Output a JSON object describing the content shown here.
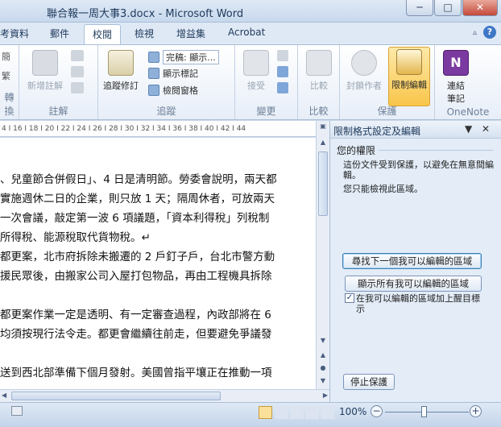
{
  "window": {
    "title": "聯合報一周大事3.docx - Microsoft Word",
    "minimize": "─",
    "maximize": "□",
    "close": "✕"
  },
  "tabs": [
    "考資料",
    "郵件",
    "校閱",
    "檢視",
    "增益集",
    "Acrobat"
  ],
  "active_tab": "校閱",
  "ribbon": {
    "groups": {
      "proofing": "轉換",
      "comments": "註解",
      "tracking": "追蹤",
      "changes": "變更",
      "compare": "比較",
      "protect": "保護",
      "onenote": "OneNote"
    },
    "left_partial_labels": [
      "簡",
      "繁",
      "轉換"
    ],
    "new_comment": "新增註解",
    "track_changes": "追蹤修訂",
    "final_markup_dropdown": "完稿: 顯示...",
    "show_markup": "顯示標記",
    "reviewing_pane": "檢閱窗格",
    "accept": "接受",
    "compare": "比較",
    "block_authors": "封鎖作者",
    "restrict_editing": "限制編輯",
    "linked_notes": "連結\n筆記"
  },
  "ruler_text": "4 I 16 I 18 I 20 I 22 I 24 I 26 I 28 I 30 I 32 I 34 I 36 I 38 I 40 I 42 I 44",
  "document": {
    "lines": [
      "、兒童節合併假日」、4 日是清明節。勞委會說明，兩天都",
      "實施週休二日的企業，則只放 1 天；隔周休者，可放兩天",
      "一次會議，敲定第一波 6 項議題，「資本利得稅」列稅制",
      "所得稅、能源稅取代貨物稅。↵",
      "都更案，北市府拆除未搬遷的 2 戶釘子戶，台北市警方動",
      "援民眾後，由搬家公司入屋打包物品，再由工程機具拆除",
      "",
      "都更案作業一定是透明、有一定審查過程，內政部將在 6",
      "均須按現行法令走。都更會繼續往前走，但要避免爭議發",
      "",
      "送到西北部準備下個月發射。美國曾指平壤正在推動一項"
    ]
  },
  "pane": {
    "title": "限制格式設定及編輯",
    "section": "您的權限",
    "text1": "這份文件受到保護，以避免在無意間編輯。",
    "text2": "您只能檢視此區域。",
    "btn_find_next": "尋找下一個我可以編輯的區域",
    "btn_show_all": "顯示所有我可以編輯的區域",
    "checkbox_label": "在我可以編輯的區域加上醒目標示",
    "checkbox_checked": true,
    "btn_stop": "停止保護"
  },
  "status": {
    "zoom": "100%",
    "zoom_level_percent": 100
  }
}
